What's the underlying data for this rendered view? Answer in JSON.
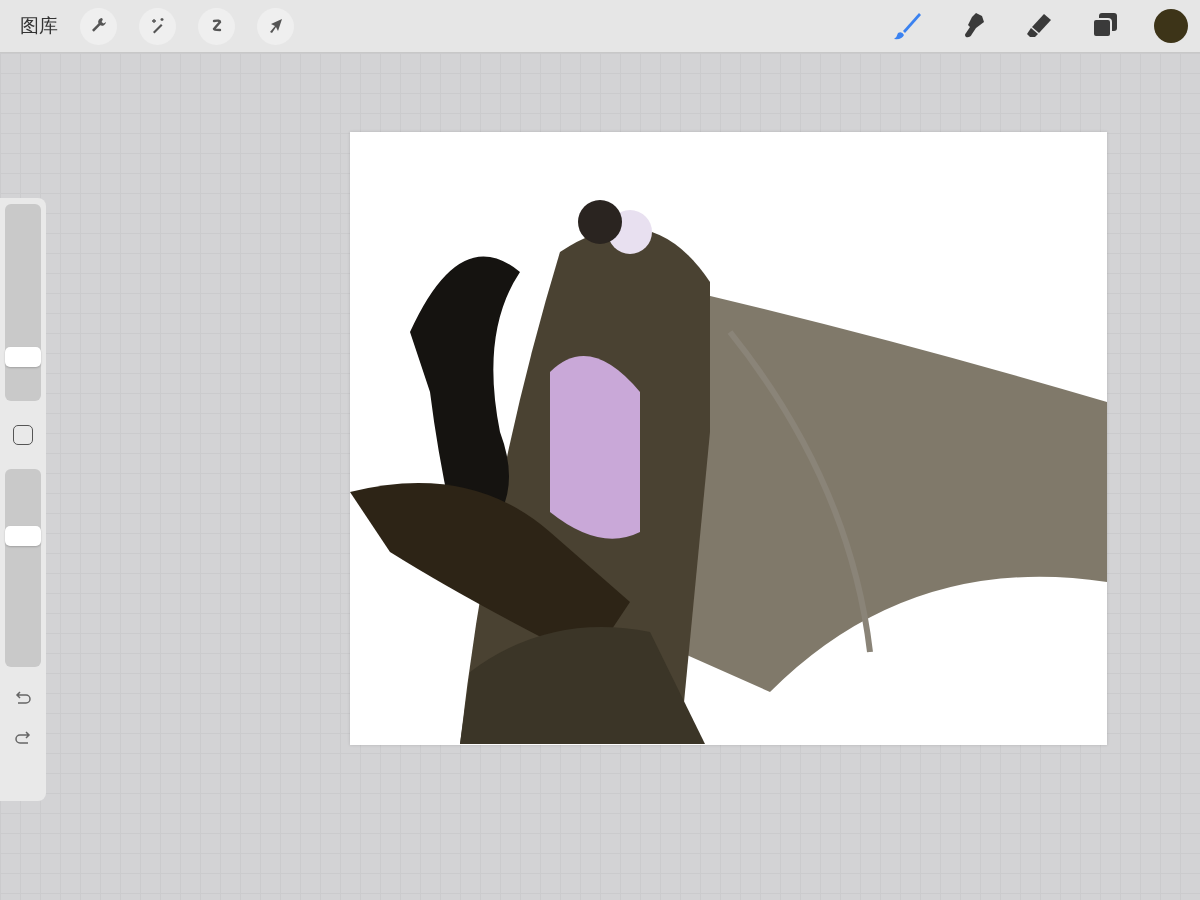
{
  "top_bar": {
    "gallery_label": "图库",
    "actions": [
      {
        "kind": "wrench"
      },
      {
        "kind": "wand"
      },
      {
        "kind": "selection"
      },
      {
        "kind": "transform"
      }
    ],
    "tools": [
      {
        "kind": "brush",
        "selected": true
      },
      {
        "kind": "smudge",
        "selected": false
      },
      {
        "kind": "eraser",
        "selected": false
      },
      {
        "kind": "layers",
        "selected": false
      }
    ],
    "color_swatch": {
      "color": "#3d3418"
    }
  },
  "sidebar": {
    "size_slider": {
      "level": 0.19
    },
    "opacity_slider": {
      "level": 0.68
    }
  }
}
